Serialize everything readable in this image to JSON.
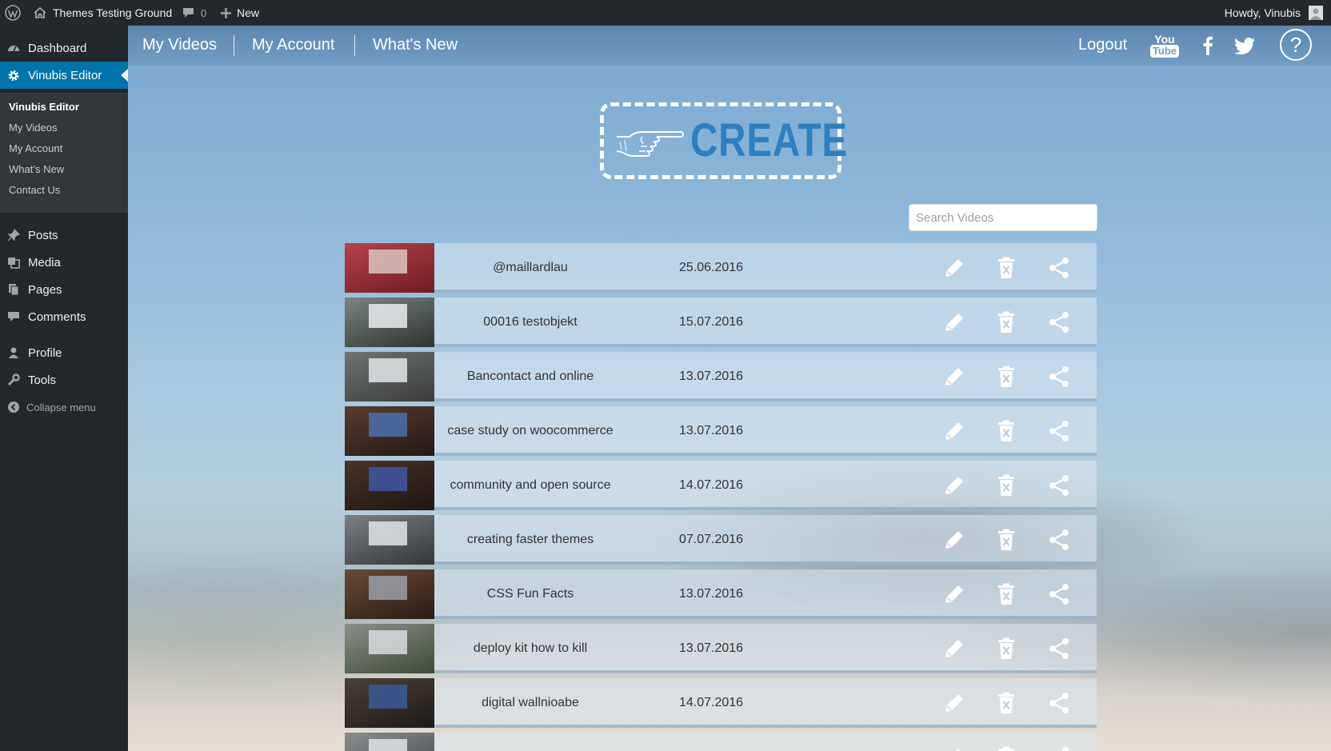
{
  "adminbar": {
    "site_name": "Themes Testing Ground",
    "comments_count": "0",
    "new_label": "New",
    "howdy": "Howdy, Vinubis"
  },
  "sidebar": {
    "items": [
      {
        "label": "Dashboard",
        "icon": "dashboard-icon"
      },
      {
        "label": "Vinubis Editor",
        "icon": "gear-icon"
      },
      {
        "label": "Posts",
        "icon": "pushpin-icon"
      },
      {
        "label": "Media",
        "icon": "media-icon"
      },
      {
        "label": "Pages",
        "icon": "pages-icon"
      },
      {
        "label": "Comments",
        "icon": "comment-icon"
      },
      {
        "label": "Profile",
        "icon": "user-icon"
      },
      {
        "label": "Tools",
        "icon": "wrench-icon"
      },
      {
        "label": "Collapse menu",
        "icon": "collapse-icon"
      }
    ],
    "submenu": [
      "Vinubis Editor",
      "My Videos",
      "My Account",
      "What’s New",
      "Contact Us"
    ]
  },
  "appnav": {
    "links": [
      "My Videos",
      "My Account",
      "What's New"
    ],
    "logout": "Logout",
    "youtube_line1": "You",
    "youtube_line2": "Tube",
    "help": "?"
  },
  "create": {
    "label": "CREATE"
  },
  "search": {
    "placeholder": "Search Videos"
  },
  "videos": [
    {
      "title": "@maillardlau",
      "date": "25.06.2016"
    },
    {
      "title": "00016 testobjekt",
      "date": "15.07.2016"
    },
    {
      "title": "Bancontact and online",
      "date": "13.07.2016"
    },
    {
      "title": "case study on woocommerce",
      "date": "13.07.2016"
    },
    {
      "title": "community and open source",
      "date": "14.07.2016"
    },
    {
      "title": "creating faster themes",
      "date": "07.07.2016"
    },
    {
      "title": "CSS Fun Facts",
      "date": "13.07.2016"
    },
    {
      "title": "deploy kit how to kill",
      "date": "13.07.2016"
    },
    {
      "title": "digital wallnioabe",
      "date": "14.07.2016"
    },
    {
      "title": "",
      "date": ""
    }
  ],
  "colors": {
    "accent": "#0073aa",
    "create": "#2f7fc0",
    "adminbar": "#23282d"
  }
}
